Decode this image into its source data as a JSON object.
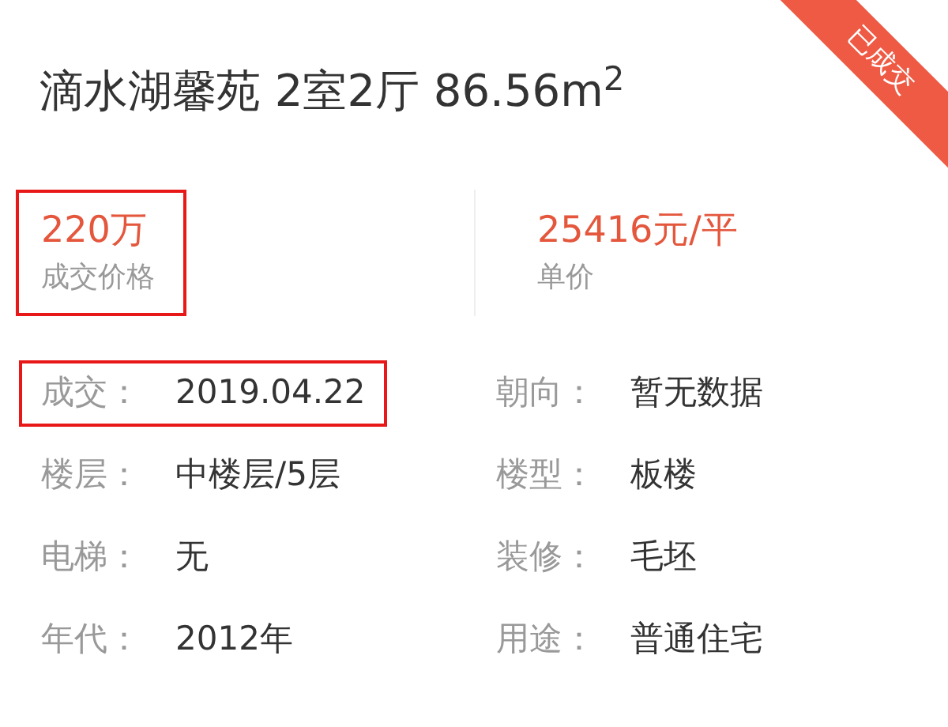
{
  "badge": "已成交",
  "title": "滴水湖馨苑 2室2厅 86.56m$^{2}$",
  "stats": [
    {
      "value": "220万",
      "label": "成交价格",
      "highlighted": true
    },
    {
      "value": "25416元/平",
      "label": "单价",
      "highlighted": false
    }
  ],
  "details": [
    {
      "label": "成交：",
      "value": "2019.04.22",
      "highlighted": true
    },
    {
      "label": "朝向：",
      "value": "暂无数据",
      "highlighted": false
    },
    {
      "label": "楼层：",
      "value": "中楼层/5层",
      "highlighted": false
    },
    {
      "label": "楼型：",
      "value": "板楼",
      "highlighted": false
    },
    {
      "label": "电梯：",
      "value": "无",
      "highlighted": false
    },
    {
      "label": "装修：",
      "value": "毛坯",
      "highlighted": false
    },
    {
      "label": "年代：",
      "value": "2012年",
      "highlighted": false
    },
    {
      "label": "用途：",
      "value": "普通住宅",
      "highlighted": false
    }
  ]
}
